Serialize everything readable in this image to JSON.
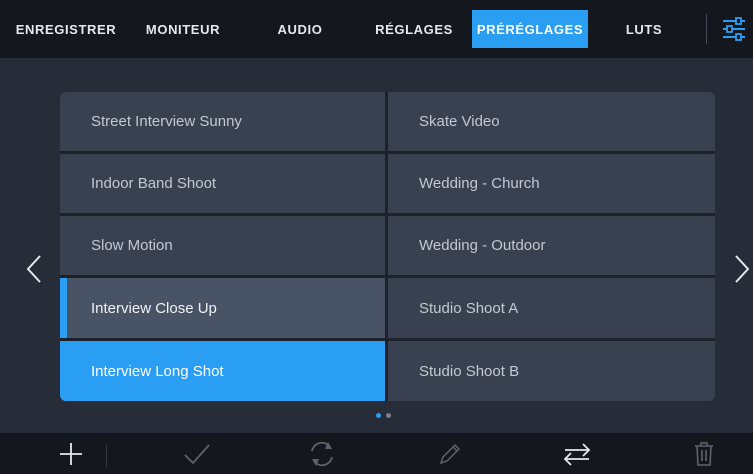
{
  "tabs": [
    {
      "label": "ENREGISTRER",
      "active": false
    },
    {
      "label": "MONITEUR",
      "active": false
    },
    {
      "label": "AUDIO",
      "active": false
    },
    {
      "label": "RÉGLAGES",
      "active": false
    },
    {
      "label": "PRÉRÉGLAGES",
      "active": true
    },
    {
      "label": "LUTS",
      "active": false
    }
  ],
  "menu_icon": "sliders-icon",
  "presets": [
    {
      "label": "Street Interview Sunny",
      "state": "normal"
    },
    {
      "label": "Skate Video",
      "state": "normal"
    },
    {
      "label": "Indoor Band Shoot",
      "state": "normal"
    },
    {
      "label": "Wedding  - Church",
      "state": "normal"
    },
    {
      "label": "Slow Motion",
      "state": "normal"
    },
    {
      "label": "Wedding - Outdoor",
      "state": "normal"
    },
    {
      "label": "Interview Close Up",
      "state": "focused"
    },
    {
      "label": "Studio Shoot A",
      "state": "normal"
    },
    {
      "label": "Interview Long Shot",
      "state": "selected"
    },
    {
      "label": "Studio Shoot B",
      "state": "normal"
    }
  ],
  "pagination": {
    "current": 1,
    "total": 2
  },
  "toolbar": [
    {
      "icon": "plus-icon",
      "enabled": true
    },
    {
      "icon": "check-icon",
      "enabled": false
    },
    {
      "icon": "refresh-icon",
      "enabled": false
    },
    {
      "icon": "pencil-icon",
      "enabled": false
    },
    {
      "icon": "transfer-icon",
      "enabled": true
    },
    {
      "icon": "trash-icon",
      "enabled": false
    }
  ],
  "colors": {
    "accent": "#2a9ef3",
    "background": "#272d38",
    "bar": "#14171d",
    "cell": "#394150"
  }
}
